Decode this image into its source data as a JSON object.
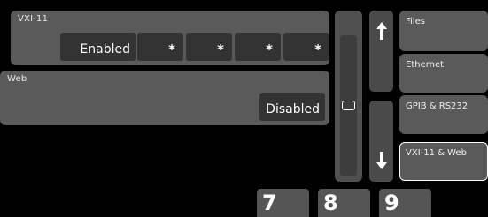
{
  "vxi11": {
    "title": "VXI-11",
    "status": "Enabled",
    "ip_fields": [
      "*",
      "*",
      "*",
      "*"
    ]
  },
  "web": {
    "title": "Web",
    "status": "Disabled"
  },
  "scroll": {
    "up_icon": "arrow-up",
    "down_icon": "arrow-down"
  },
  "menu": {
    "items": [
      {
        "label": "Files",
        "active": false
      },
      {
        "label": "Ethernet",
        "active": false
      },
      {
        "label": "GPIB & RS232",
        "active": false
      },
      {
        "label": "VXI-11 & Web",
        "active": true
      }
    ]
  },
  "keypad": {
    "keys": [
      "7",
      "8",
      "9"
    ]
  },
  "colors": {
    "background": "#000000",
    "panel": "#5a5a5a",
    "field": "#333333",
    "text": "#ffffff"
  }
}
